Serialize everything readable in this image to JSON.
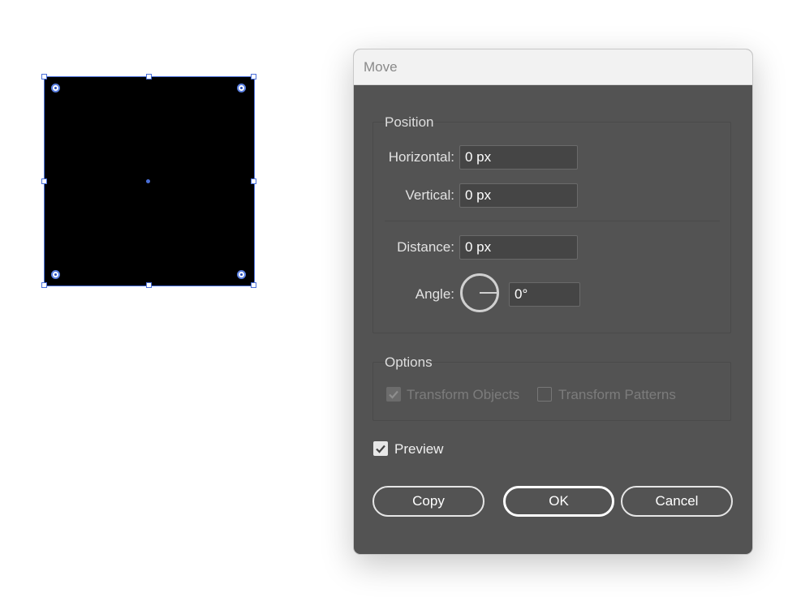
{
  "dialog": {
    "title": "Move",
    "position": {
      "title": "Position",
      "horizontal_label": "Horizontal:",
      "horizontal_value": "0 px",
      "vertical_label": "Vertical:",
      "vertical_value": "0 px",
      "distance_label": "Distance:",
      "distance_value": "0 px",
      "angle_label": "Angle:",
      "angle_value": "0°"
    },
    "options": {
      "title": "Options",
      "transform_objects": {
        "label": "Transform Objects",
        "checked": true,
        "disabled": true
      },
      "transform_patterns": {
        "label": "Transform Patterns",
        "checked": false,
        "disabled": true
      }
    },
    "preview": {
      "label": "Preview",
      "checked": true
    },
    "buttons": {
      "copy": "Copy",
      "ok": "OK",
      "cancel": "Cancel"
    }
  },
  "colors": {
    "dialog_bg": "#535353",
    "selection": "#4a6fd8",
    "object_fill": "#000000"
  }
}
